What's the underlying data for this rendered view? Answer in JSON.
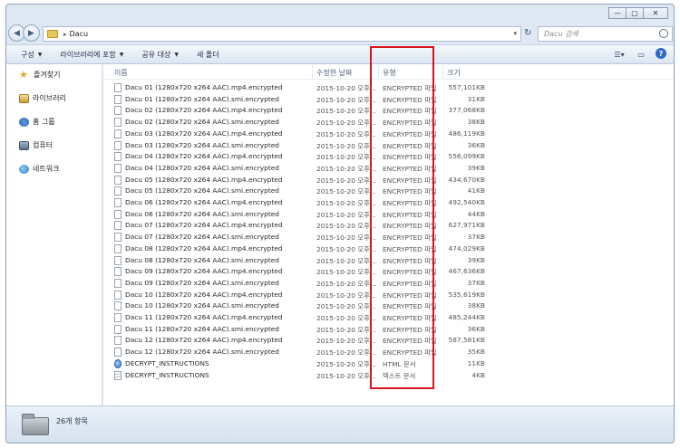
{
  "window": {
    "controls": [
      "—",
      "▢",
      "✕"
    ]
  },
  "address": {
    "path": "Dacu",
    "search_placeholder": "Dacu 검색"
  },
  "toolbar": {
    "organize": "구성",
    "include_library": "라이브러리에 포함",
    "share": "공유 대상",
    "new_folder": "새 폴더"
  },
  "nav": {
    "favorites": "즐겨찾기",
    "libraries": "라이브러리",
    "homegroup": "홈 그룹",
    "computer": "컴퓨터",
    "network": "네트워크"
  },
  "columns": {
    "name": "이름",
    "date": "수정한 날짜",
    "type": "유형",
    "size": "크기"
  },
  "files": [
    {
      "name": "Dacu 01 (1280x720 x264 AAC).mp4.encrypted",
      "date": "2015-10-20 오후...",
      "type": "ENCRYPTED 파일",
      "size": "557,101KB",
      "icon": "file"
    },
    {
      "name": "Dacu 01 (1280x720 x264 AAC).smi.encrypted",
      "date": "2015-10-20 오후...",
      "type": "ENCRYPTED 파일",
      "size": "31KB",
      "icon": "file"
    },
    {
      "name": "Dacu 02 (1280x720 x264 AAC).mp4.encrypted",
      "date": "2015-10-20 오후...",
      "type": "ENCRYPTED 파일",
      "size": "377,068KB",
      "icon": "file"
    },
    {
      "name": "Dacu 02 (1280x720 x264 AAC).smi.encrypted",
      "date": "2015-10-20 오후...",
      "type": "ENCRYPTED 파일",
      "size": "38KB",
      "icon": "file"
    },
    {
      "name": "Dacu 03 (1280x720 x264 AAC).mp4.encrypted",
      "date": "2015-10-20 오후...",
      "type": "ENCRYPTED 파일",
      "size": "486,119KB",
      "icon": "file"
    },
    {
      "name": "Dacu 03 (1280x720 x264 AAC).smi.encrypted",
      "date": "2015-10-20 오후...",
      "type": "ENCRYPTED 파일",
      "size": "36KB",
      "icon": "file"
    },
    {
      "name": "Dacu 04 (1280x720 x264 AAC).mp4.encrypted",
      "date": "2015-10-20 오후...",
      "type": "ENCRYPTED 파일",
      "size": "556,099KB",
      "icon": "file"
    },
    {
      "name": "Dacu 04 (1280x720 x264 AAC).smi.encrypted",
      "date": "2015-10-20 오후...",
      "type": "ENCRYPTED 파일",
      "size": "39KB",
      "icon": "file"
    },
    {
      "name": "Dacu 05 (1280x720 x264 AAC).mp4.encrypted",
      "date": "2015-10-20 오후...",
      "type": "ENCRYPTED 파일",
      "size": "434,670KB",
      "icon": "file"
    },
    {
      "name": "Dacu 05 (1280x720 x264 AAC).smi.encrypted",
      "date": "2015-10-20 오후...",
      "type": "ENCRYPTED 파일",
      "size": "41KB",
      "icon": "file"
    },
    {
      "name": "Dacu 06 (1280x720 x264 AAC).mp4.encrypted",
      "date": "2015-10-20 오후...",
      "type": "ENCRYPTED 파일",
      "size": "492,540KB",
      "icon": "file"
    },
    {
      "name": "Dacu 06 (1280x720 x264 AAC).smi.encrypted",
      "date": "2015-10-20 오후...",
      "type": "ENCRYPTED 파일",
      "size": "44KB",
      "icon": "file"
    },
    {
      "name": "Dacu 07 (1280x720 x264 AAC).mp4.encrypted",
      "date": "2015-10-20 오후...",
      "type": "ENCRYPTED 파일",
      "size": "627,971KB",
      "icon": "file"
    },
    {
      "name": "Dacu 07 (1280x720 x264 AAC).smi.encrypted",
      "date": "2015-10-20 오후...",
      "type": "ENCRYPTED 파일",
      "size": "37KB",
      "icon": "file"
    },
    {
      "name": "Dacu 08 (1280x720 x264 AAC).mp4.encrypted",
      "date": "2015-10-20 오후...",
      "type": "ENCRYPTED 파일",
      "size": "474,029KB",
      "icon": "file"
    },
    {
      "name": "Dacu 08 (1280x720 x264 AAC).smi.encrypted",
      "date": "2015-10-20 오후...",
      "type": "ENCRYPTED 파일",
      "size": "39KB",
      "icon": "file"
    },
    {
      "name": "Dacu 09 (1280x720 x264 AAC).mp4.encrypted",
      "date": "2015-10-20 오후...",
      "type": "ENCRYPTED 파일",
      "size": "467,636KB",
      "icon": "file"
    },
    {
      "name": "Dacu 09 (1280x720 x264 AAC).smi.encrypted",
      "date": "2015-10-20 오후...",
      "type": "ENCRYPTED 파일",
      "size": "37KB",
      "icon": "file"
    },
    {
      "name": "Dacu 10 (1280x720 x264 AAC).mp4.encrypted",
      "date": "2015-10-20 오후...",
      "type": "ENCRYPTED 파일",
      "size": "535,619KB",
      "icon": "file"
    },
    {
      "name": "Dacu 10 (1280x720 x264 AAC).smi.encrypted",
      "date": "2015-10-20 오후...",
      "type": "ENCRYPTED 파일",
      "size": "38KB",
      "icon": "file"
    },
    {
      "name": "Dacu 11 (1280x720 x264 AAC).mp4.encrypted",
      "date": "2015-10-20 오후...",
      "type": "ENCRYPTED 파일",
      "size": "485,244KB",
      "icon": "file"
    },
    {
      "name": "Dacu 11 (1280x720 x264 AAC).smi.encrypted",
      "date": "2015-10-20 오후...",
      "type": "ENCRYPTED 파일",
      "size": "36KB",
      "icon": "file"
    },
    {
      "name": "Dacu 12 (1280x720 x264 AAC).mp4.encrypted",
      "date": "2015-10-20 오후...",
      "type": "ENCRYPTED 파일",
      "size": "587,581KB",
      "icon": "file"
    },
    {
      "name": "Dacu 12 (1280x720 x264 AAC).smi.encrypted",
      "date": "2015-10-20 오후...",
      "type": "ENCRYPTED 파일",
      "size": "35KB",
      "icon": "file"
    },
    {
      "name": "DECRYPT_INSTRUCTIONS",
      "date": "2015-10-20 오후...",
      "type": "HTML 문서",
      "size": "11KB",
      "icon": "html"
    },
    {
      "name": "DECRYPT_INSTRUCTIONS",
      "date": "2015-10-20 오후...",
      "type": "텍스트 문서",
      "size": "4KB",
      "icon": "txt"
    }
  ],
  "details": {
    "count": "26개 항목"
  },
  "colors": {
    "highlight": "#d8141b",
    "accent": "#2c6bc7"
  }
}
